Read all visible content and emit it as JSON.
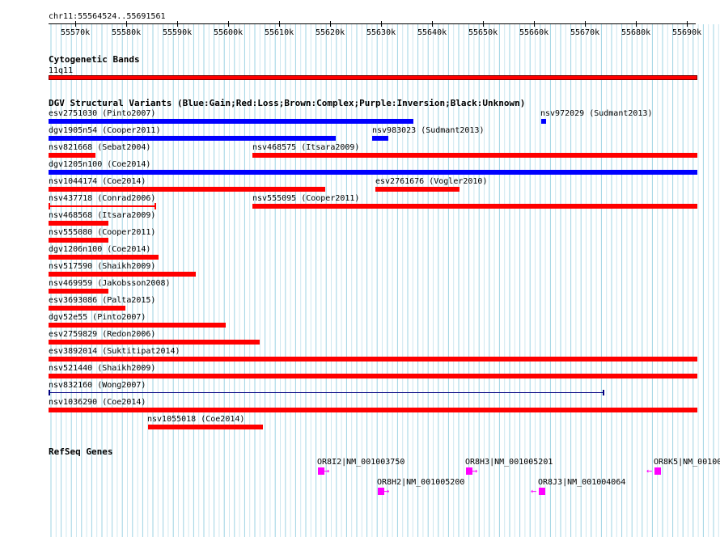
{
  "ruler": {
    "location": "chr11:55564524..55691561",
    "ticks": [
      "55570k",
      "55580k",
      "55590k",
      "55600k",
      "55610k",
      "55620k",
      "55630k",
      "55640k",
      "55650k",
      "55660k",
      "55670k",
      "55680k",
      "55690k"
    ]
  },
  "cytobands": {
    "title": "Cytogenetic Bands",
    "band_label": "11q11",
    "band_color": "#ff0000"
  },
  "dgv": {
    "title": "DGV Structural Variants (Blue:Gain;Red:Loss;Brown:Complex;Purple:Inversion;Black:Unknown)",
    "colors": {
      "gain": "#0000ff",
      "loss": "#ff0000",
      "unknown": "#000080"
    },
    "features": [
      {
        "label": "esv2751030 (Pinto2007)",
        "type": "gain"
      },
      {
        "label": "nsv972029 (Sudmant2013)",
        "type": "gain"
      },
      {
        "label": "dgv1905n54 (Cooper2011)",
        "type": "gain"
      },
      {
        "label": "nsv983023 (Sudmant2013)",
        "type": "gain"
      },
      {
        "label": "nsv821668 (Sebat2004)",
        "type": "loss"
      },
      {
        "label": "nsv468575 (Itsara2009)",
        "type": "loss"
      },
      {
        "label": "dgv1205n100 (Coe2014)",
        "type": "gain"
      },
      {
        "label": "nsv1044174 (Coe2014)",
        "type": "loss"
      },
      {
        "label": "esv2761676 (Vogler2010)",
        "type": "loss"
      },
      {
        "label": "nsv437718 (Conrad2006)",
        "type": "loss"
      },
      {
        "label": "nsv555095 (Cooper2011)",
        "type": "loss"
      },
      {
        "label": "nsv468568 (Itsara2009)",
        "type": "loss"
      },
      {
        "label": "nsv555080 (Cooper2011)",
        "type": "loss"
      },
      {
        "label": "dgv1206n100 (Coe2014)",
        "type": "loss"
      },
      {
        "label": "nsv517590 (Shaikh2009)",
        "type": "loss"
      },
      {
        "label": "nsv469959 (Jakobsson2008)",
        "type": "loss"
      },
      {
        "label": "esv3693086 (Palta2015)",
        "type": "loss"
      },
      {
        "label": "dgv52e55 (Pinto2007)",
        "type": "loss"
      },
      {
        "label": "esv2759829 (Redon2006)",
        "type": "loss"
      },
      {
        "label": "esv3892014 (Suktitipat2014)",
        "type": "loss"
      },
      {
        "label": "nsv521440 (Shaikh2009)",
        "type": "loss"
      },
      {
        "label": "nsv832160 (Wong2007)",
        "type": "unknown"
      },
      {
        "label": "nsv1036290 (Coe2014)",
        "type": "loss"
      },
      {
        "label": "nsv1055018 (Coe2014)",
        "type": "loss"
      }
    ]
  },
  "refseq": {
    "title": "RefSeq Genes",
    "gene_color": "#ff00ff",
    "genes": [
      {
        "label": "OR8I2|NM_001003750",
        "strand": "+"
      },
      {
        "label": "OR8H3|NM_001005201",
        "strand": "+"
      },
      {
        "label": "OR8K5|NM_00100",
        "strand": "-"
      },
      {
        "label": "OR8H2|NM_001005200",
        "strand": "+"
      },
      {
        "label": "OR8J3|NM_001004064",
        "strand": "-"
      }
    ]
  }
}
